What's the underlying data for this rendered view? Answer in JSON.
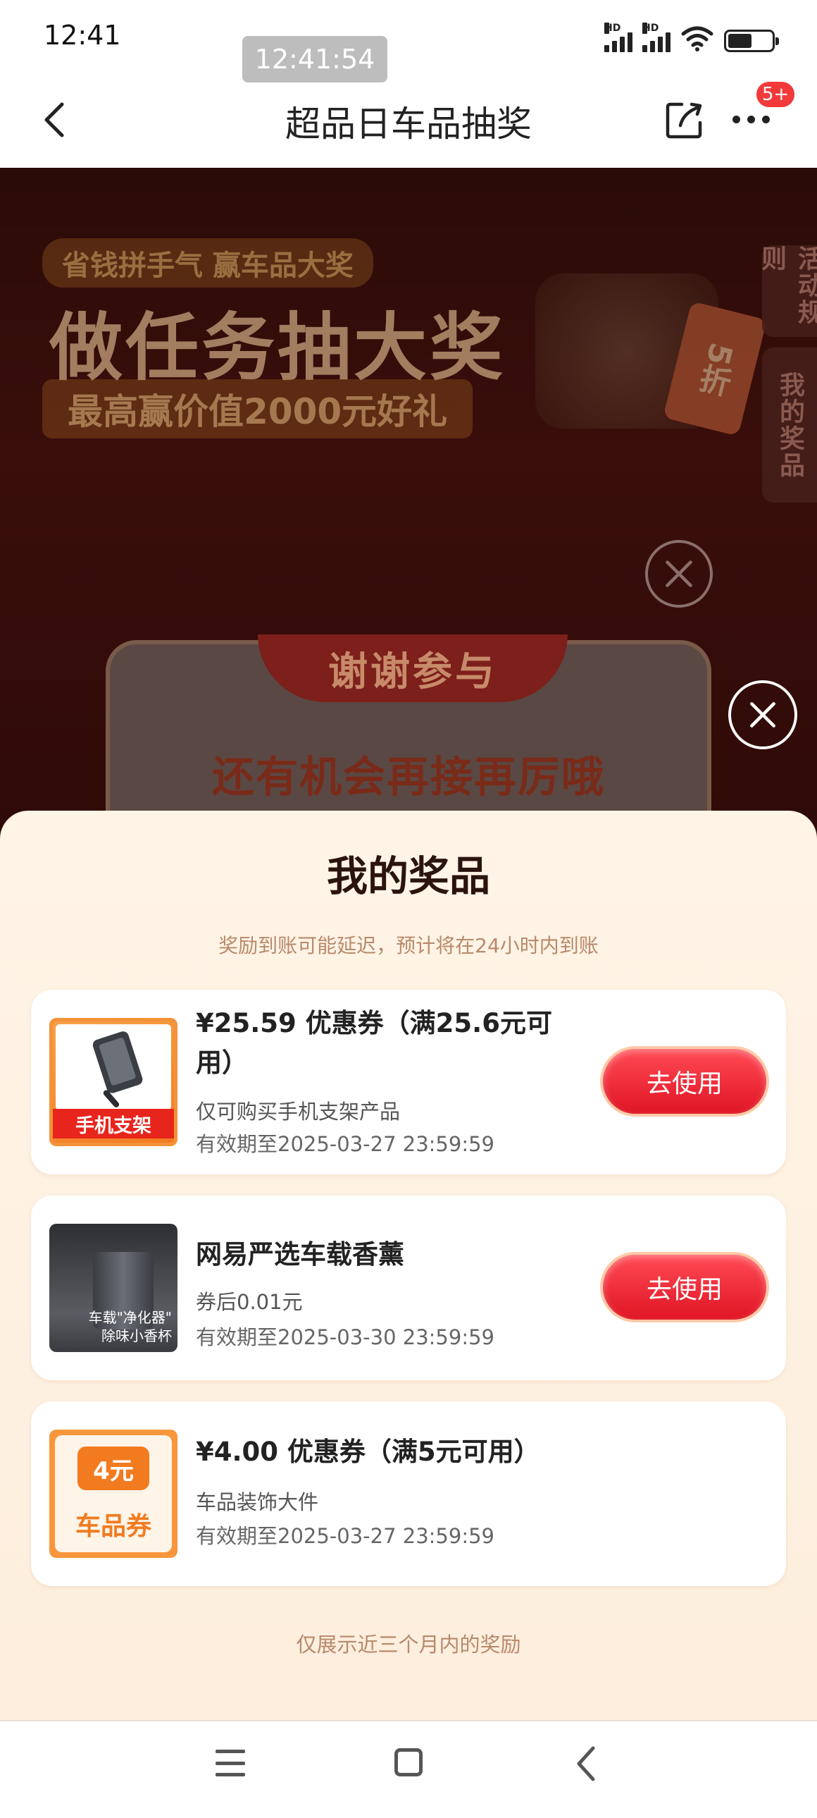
{
  "status_bar": {
    "time": "12:41",
    "screen_time_chip": "12:41:54",
    "signal_1_label": "HD",
    "signal_2_label": "HD",
    "battery_level": 0.55
  },
  "nav": {
    "title": "超品日车品抽奖",
    "more_badge": "5+"
  },
  "activity": {
    "hero_tag": "省钱拼手气 赢车品大奖",
    "hero_title": "做任务抽大奖",
    "hero_subtitle": "最高赢价值2000元好礼",
    "hero_discount": "5折",
    "side_rules": "活动规则",
    "side_prizes": "我的奖品",
    "result_ribbon": "谢谢参与",
    "result_message": "还有机会再接再厉哦"
  },
  "sheet": {
    "title": "我的奖品",
    "note": "奖励到账可能延迟，预计将在24小时内到账",
    "footer": "仅展示近三个月内的奖励",
    "prizes": [
      {
        "name_line1": "¥25.59 优惠券（满25.6元可",
        "name_line2": "用）",
        "desc": "仅可购买手机支架产品",
        "expiry": "有效期至2025-03-27 23:59:59",
        "image_label": "手机支架",
        "button": "去使用"
      },
      {
        "name_line1": "网易严选车载香薰",
        "desc": "券后0.01元",
        "expiry": "有效期至2025-03-30 23:59:59",
        "image_label_1": "车载\"净化器\"",
        "image_label_2": "除味小香杯",
        "button": "去使用"
      },
      {
        "name_line1": "¥4.00 优惠券（满5元可用）",
        "desc": "车品装饰大件",
        "expiry": "有效期至2025-03-27 23:59:59",
        "image_amount": "4元",
        "image_category": "车品券"
      }
    ]
  },
  "colors": {
    "accent_red": "#e01524",
    "sheet_bg": "#fff4e6",
    "badge_red": "#f23a3a",
    "orange": "#f27b20"
  }
}
